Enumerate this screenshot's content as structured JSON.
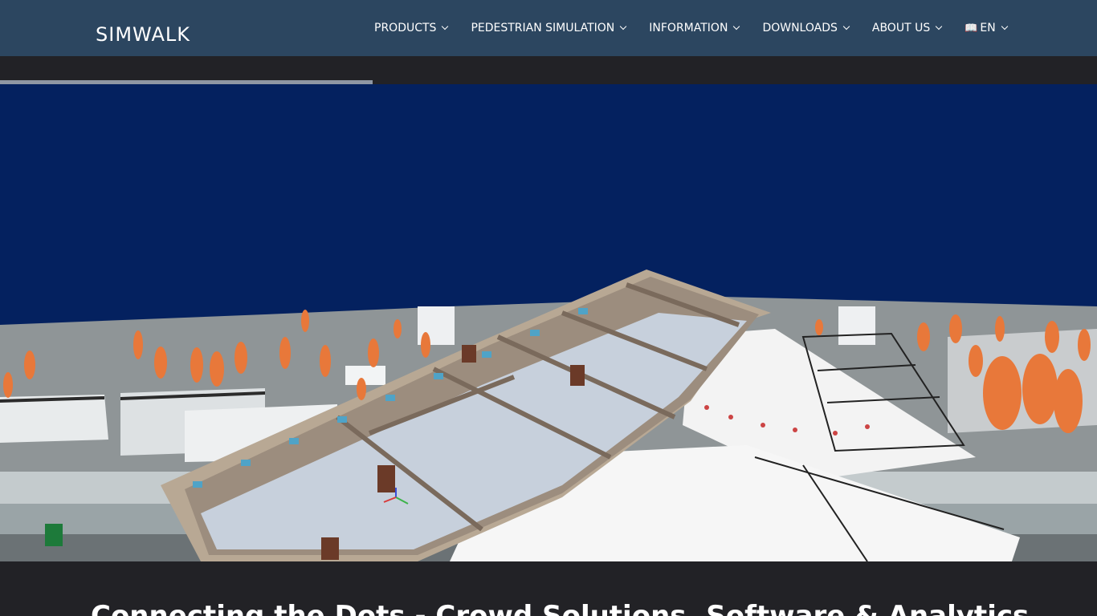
{
  "header": {
    "logo_text": "SIMWALK",
    "nav": [
      {
        "label": "PRODUCTS"
      },
      {
        "label": "PEDESTRIAN SIMULATION"
      },
      {
        "label": "INFORMATION"
      },
      {
        "label": "DOWNLOADS"
      },
      {
        "label": "ABOUT US"
      },
      {
        "label": "EN",
        "icon": "language-icon"
      }
    ]
  },
  "slider": {
    "progress_fraction": 0.34
  },
  "hero": {
    "image": "3D building model with floor plans and crowd simulation figures"
  },
  "main": {
    "headline": "Connecting the Dots - Crowd Solutions, Software & Analytics"
  },
  "colors": {
    "header_bg": "#2c4660",
    "hero_bg": "#04215f",
    "figure_color": "#e8783a",
    "page_bg": "#222226"
  }
}
